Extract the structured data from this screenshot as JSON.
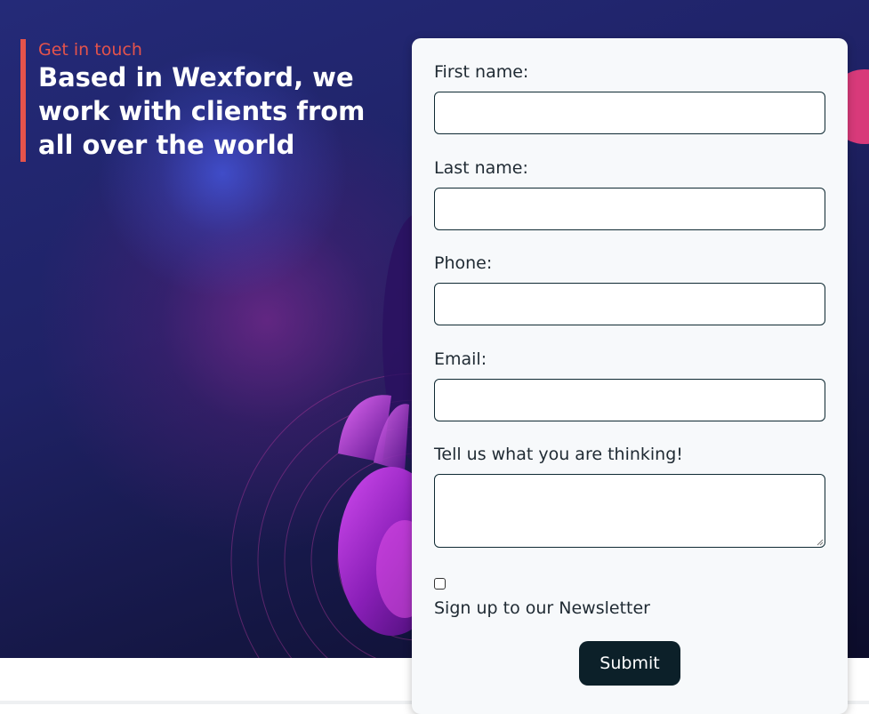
{
  "intro": {
    "eyebrow": "Get in touch",
    "headline": "Based in Wexford, we work with clients from all over the world"
  },
  "form": {
    "fields": [
      {
        "label": "First name:"
      },
      {
        "label": "Last name:"
      },
      {
        "label": "Phone:"
      },
      {
        "label": "Email:"
      }
    ],
    "message_label": "Tell us what you are thinking!",
    "newsletter_label": "Sign up to our Newsletter",
    "newsletter_checked": false,
    "submit_label": "Submit"
  },
  "colors": {
    "accent": "#e5534b",
    "card": "#f7f9fb",
    "button": "#0c2029",
    "hero_dark": "#141642"
  }
}
